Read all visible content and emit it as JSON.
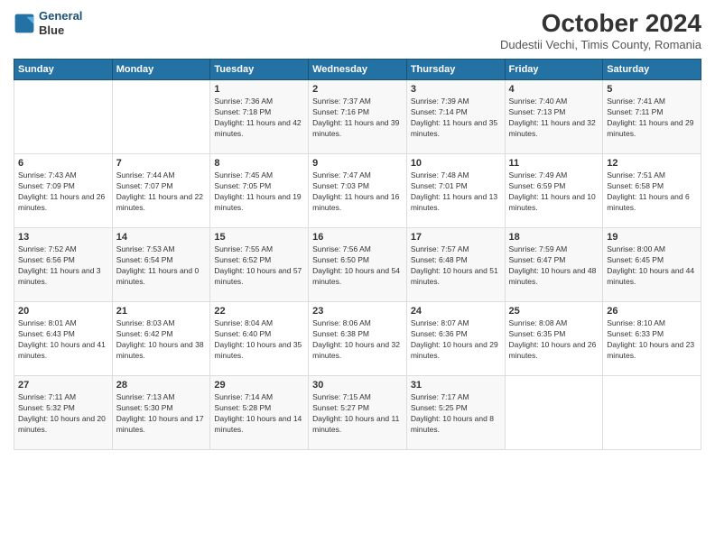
{
  "logo": {
    "line1": "General",
    "line2": "Blue"
  },
  "title": "October 2024",
  "subtitle": "Dudestii Vechi, Timis County, Romania",
  "weekdays": [
    "Sunday",
    "Monday",
    "Tuesday",
    "Wednesday",
    "Thursday",
    "Friday",
    "Saturday"
  ],
  "weeks": [
    [
      {
        "day": "",
        "sunrise": "",
        "sunset": "",
        "daylight": ""
      },
      {
        "day": "",
        "sunrise": "",
        "sunset": "",
        "daylight": ""
      },
      {
        "day": "1",
        "sunrise": "Sunrise: 7:36 AM",
        "sunset": "Sunset: 7:18 PM",
        "daylight": "Daylight: 11 hours and 42 minutes."
      },
      {
        "day": "2",
        "sunrise": "Sunrise: 7:37 AM",
        "sunset": "Sunset: 7:16 PM",
        "daylight": "Daylight: 11 hours and 39 minutes."
      },
      {
        "day": "3",
        "sunrise": "Sunrise: 7:39 AM",
        "sunset": "Sunset: 7:14 PM",
        "daylight": "Daylight: 11 hours and 35 minutes."
      },
      {
        "day": "4",
        "sunrise": "Sunrise: 7:40 AM",
        "sunset": "Sunset: 7:13 PM",
        "daylight": "Daylight: 11 hours and 32 minutes."
      },
      {
        "day": "5",
        "sunrise": "Sunrise: 7:41 AM",
        "sunset": "Sunset: 7:11 PM",
        "daylight": "Daylight: 11 hours and 29 minutes."
      }
    ],
    [
      {
        "day": "6",
        "sunrise": "Sunrise: 7:43 AM",
        "sunset": "Sunset: 7:09 PM",
        "daylight": "Daylight: 11 hours and 26 minutes."
      },
      {
        "day": "7",
        "sunrise": "Sunrise: 7:44 AM",
        "sunset": "Sunset: 7:07 PM",
        "daylight": "Daylight: 11 hours and 22 minutes."
      },
      {
        "day": "8",
        "sunrise": "Sunrise: 7:45 AM",
        "sunset": "Sunset: 7:05 PM",
        "daylight": "Daylight: 11 hours and 19 minutes."
      },
      {
        "day": "9",
        "sunrise": "Sunrise: 7:47 AM",
        "sunset": "Sunset: 7:03 PM",
        "daylight": "Daylight: 11 hours and 16 minutes."
      },
      {
        "day": "10",
        "sunrise": "Sunrise: 7:48 AM",
        "sunset": "Sunset: 7:01 PM",
        "daylight": "Daylight: 11 hours and 13 minutes."
      },
      {
        "day": "11",
        "sunrise": "Sunrise: 7:49 AM",
        "sunset": "Sunset: 6:59 PM",
        "daylight": "Daylight: 11 hours and 10 minutes."
      },
      {
        "day": "12",
        "sunrise": "Sunrise: 7:51 AM",
        "sunset": "Sunset: 6:58 PM",
        "daylight": "Daylight: 11 hours and 6 minutes."
      }
    ],
    [
      {
        "day": "13",
        "sunrise": "Sunrise: 7:52 AM",
        "sunset": "Sunset: 6:56 PM",
        "daylight": "Daylight: 11 hours and 3 minutes."
      },
      {
        "day": "14",
        "sunrise": "Sunrise: 7:53 AM",
        "sunset": "Sunset: 6:54 PM",
        "daylight": "Daylight: 11 hours and 0 minutes."
      },
      {
        "day": "15",
        "sunrise": "Sunrise: 7:55 AM",
        "sunset": "Sunset: 6:52 PM",
        "daylight": "Daylight: 10 hours and 57 minutes."
      },
      {
        "day": "16",
        "sunrise": "Sunrise: 7:56 AM",
        "sunset": "Sunset: 6:50 PM",
        "daylight": "Daylight: 10 hours and 54 minutes."
      },
      {
        "day": "17",
        "sunrise": "Sunrise: 7:57 AM",
        "sunset": "Sunset: 6:48 PM",
        "daylight": "Daylight: 10 hours and 51 minutes."
      },
      {
        "day": "18",
        "sunrise": "Sunrise: 7:59 AM",
        "sunset": "Sunset: 6:47 PM",
        "daylight": "Daylight: 10 hours and 48 minutes."
      },
      {
        "day": "19",
        "sunrise": "Sunrise: 8:00 AM",
        "sunset": "Sunset: 6:45 PM",
        "daylight": "Daylight: 10 hours and 44 minutes."
      }
    ],
    [
      {
        "day": "20",
        "sunrise": "Sunrise: 8:01 AM",
        "sunset": "Sunset: 6:43 PM",
        "daylight": "Daylight: 10 hours and 41 minutes."
      },
      {
        "day": "21",
        "sunrise": "Sunrise: 8:03 AM",
        "sunset": "Sunset: 6:42 PM",
        "daylight": "Daylight: 10 hours and 38 minutes."
      },
      {
        "day": "22",
        "sunrise": "Sunrise: 8:04 AM",
        "sunset": "Sunset: 6:40 PM",
        "daylight": "Daylight: 10 hours and 35 minutes."
      },
      {
        "day": "23",
        "sunrise": "Sunrise: 8:06 AM",
        "sunset": "Sunset: 6:38 PM",
        "daylight": "Daylight: 10 hours and 32 minutes."
      },
      {
        "day": "24",
        "sunrise": "Sunrise: 8:07 AM",
        "sunset": "Sunset: 6:36 PM",
        "daylight": "Daylight: 10 hours and 29 minutes."
      },
      {
        "day": "25",
        "sunrise": "Sunrise: 8:08 AM",
        "sunset": "Sunset: 6:35 PM",
        "daylight": "Daylight: 10 hours and 26 minutes."
      },
      {
        "day": "26",
        "sunrise": "Sunrise: 8:10 AM",
        "sunset": "Sunset: 6:33 PM",
        "daylight": "Daylight: 10 hours and 23 minutes."
      }
    ],
    [
      {
        "day": "27",
        "sunrise": "Sunrise: 7:11 AM",
        "sunset": "Sunset: 5:32 PM",
        "daylight": "Daylight: 10 hours and 20 minutes."
      },
      {
        "day": "28",
        "sunrise": "Sunrise: 7:13 AM",
        "sunset": "Sunset: 5:30 PM",
        "daylight": "Daylight: 10 hours and 17 minutes."
      },
      {
        "day": "29",
        "sunrise": "Sunrise: 7:14 AM",
        "sunset": "Sunset: 5:28 PM",
        "daylight": "Daylight: 10 hours and 14 minutes."
      },
      {
        "day": "30",
        "sunrise": "Sunrise: 7:15 AM",
        "sunset": "Sunset: 5:27 PM",
        "daylight": "Daylight: 10 hours and 11 minutes."
      },
      {
        "day": "31",
        "sunrise": "Sunrise: 7:17 AM",
        "sunset": "Sunset: 5:25 PM",
        "daylight": "Daylight: 10 hours and 8 minutes."
      },
      {
        "day": "",
        "sunrise": "",
        "sunset": "",
        "daylight": ""
      },
      {
        "day": "",
        "sunrise": "",
        "sunset": "",
        "daylight": ""
      }
    ]
  ]
}
